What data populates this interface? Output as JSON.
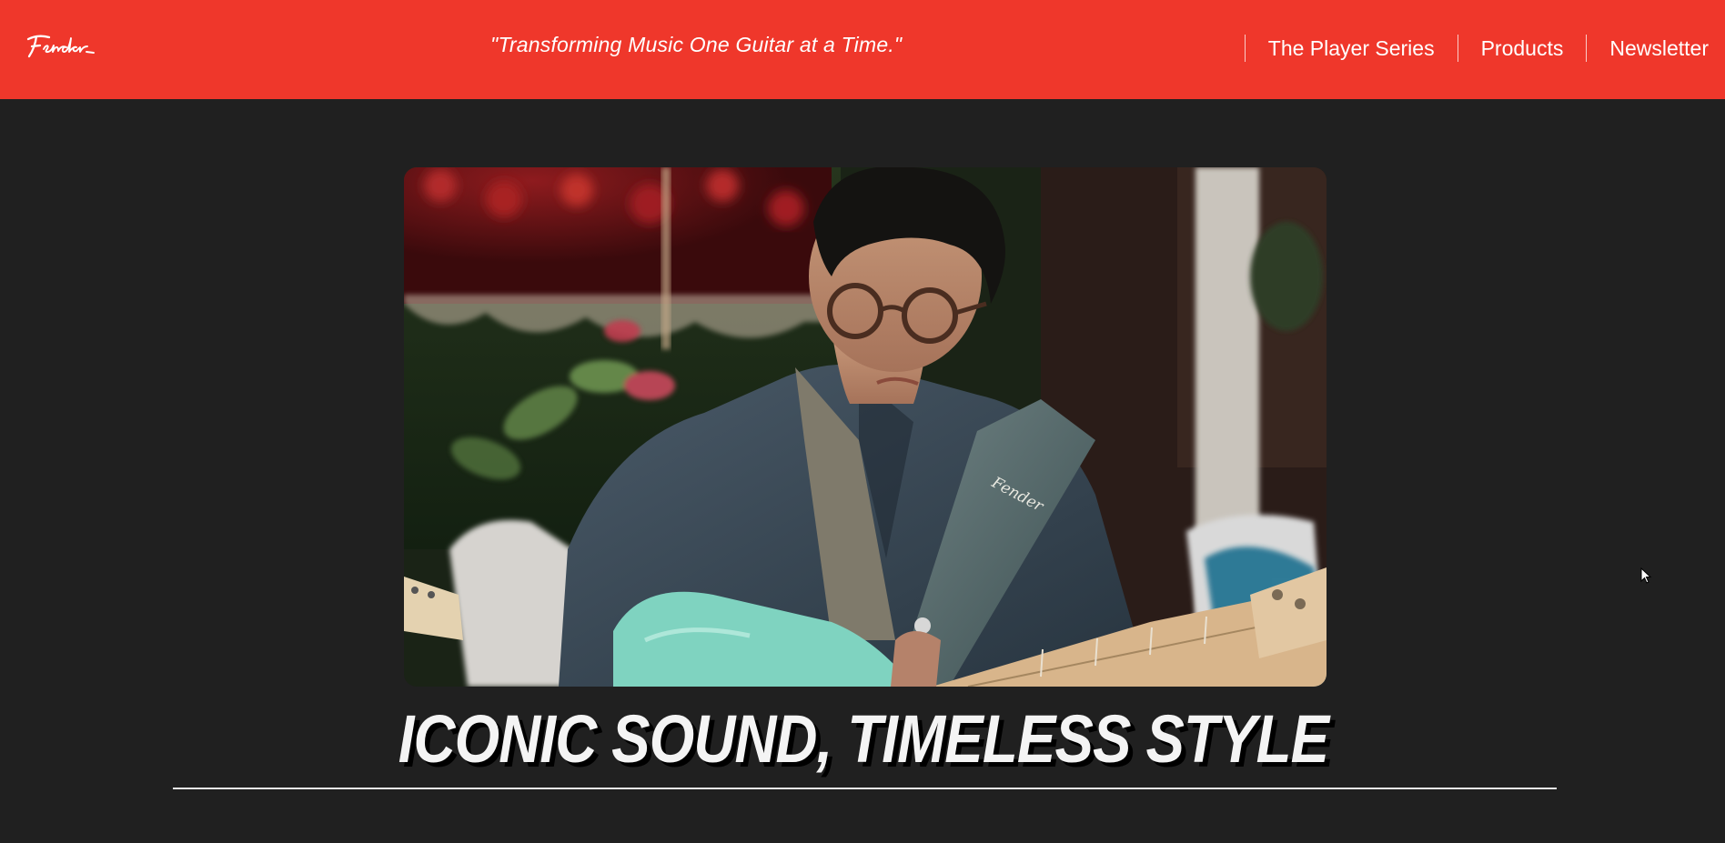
{
  "header": {
    "logo_text": "Fender",
    "logo_icon": "fender-logo-icon",
    "tagline": "\"Transforming Music One Guitar at a Time.\"",
    "nav": [
      {
        "label": "The Player Series"
      },
      {
        "label": "Products"
      },
      {
        "label": "Newsletter"
      }
    ]
  },
  "hero": {
    "image_semantic": "hero-video-frame",
    "strap_logo_text": "Fender"
  },
  "headline": "ICONIC SOUND, TIMELESS STYLE",
  "colors": {
    "header_bg": "#ef372b",
    "page_bg": "#202020",
    "headline": "#f4f4f4"
  },
  "icons": {
    "cursor": "mouse-pointer-icon"
  }
}
